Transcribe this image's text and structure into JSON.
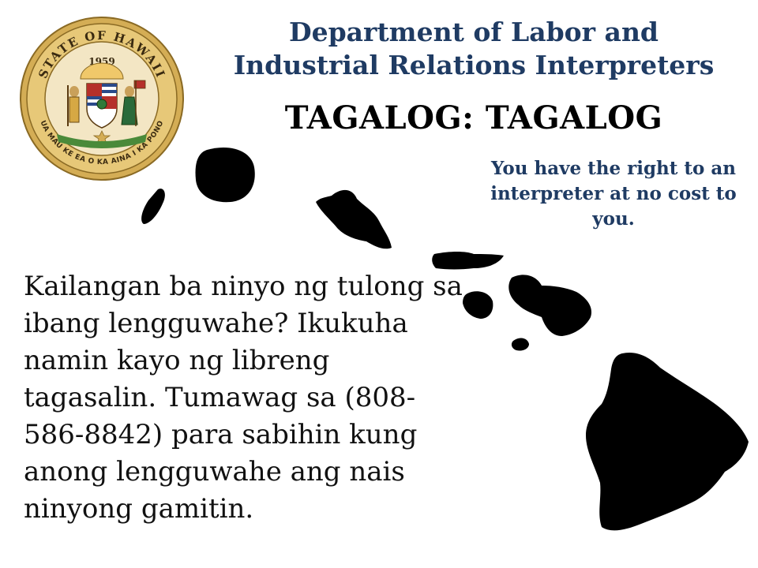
{
  "seal": {
    "top_text": "STATE OF HAWAII",
    "year": "1959",
    "motto": "UA MAU KE EA O KA AINA I KA PONO",
    "ring_color": "#c9a24a",
    "center_color": "#f3e6c4"
  },
  "header": {
    "department_title": "Department of Labor and Industrial Relations Interpreters",
    "language_heading": "TAGALOG: TAGALOG"
  },
  "right_note": "You have the right to an interpreter at no cost to you.",
  "body_message": "Kailangan ba ninyo ng tulong sa ibang lengguwahe? Ikukuha namin kayo ng libreng tagasalin. Tumawag sa (808-586-8842) para sabihin kung anong lengguwahe ang nais ninyong gamitin.",
  "colors": {
    "title_blue": "#1f3b63",
    "island_fill": "#000000"
  }
}
